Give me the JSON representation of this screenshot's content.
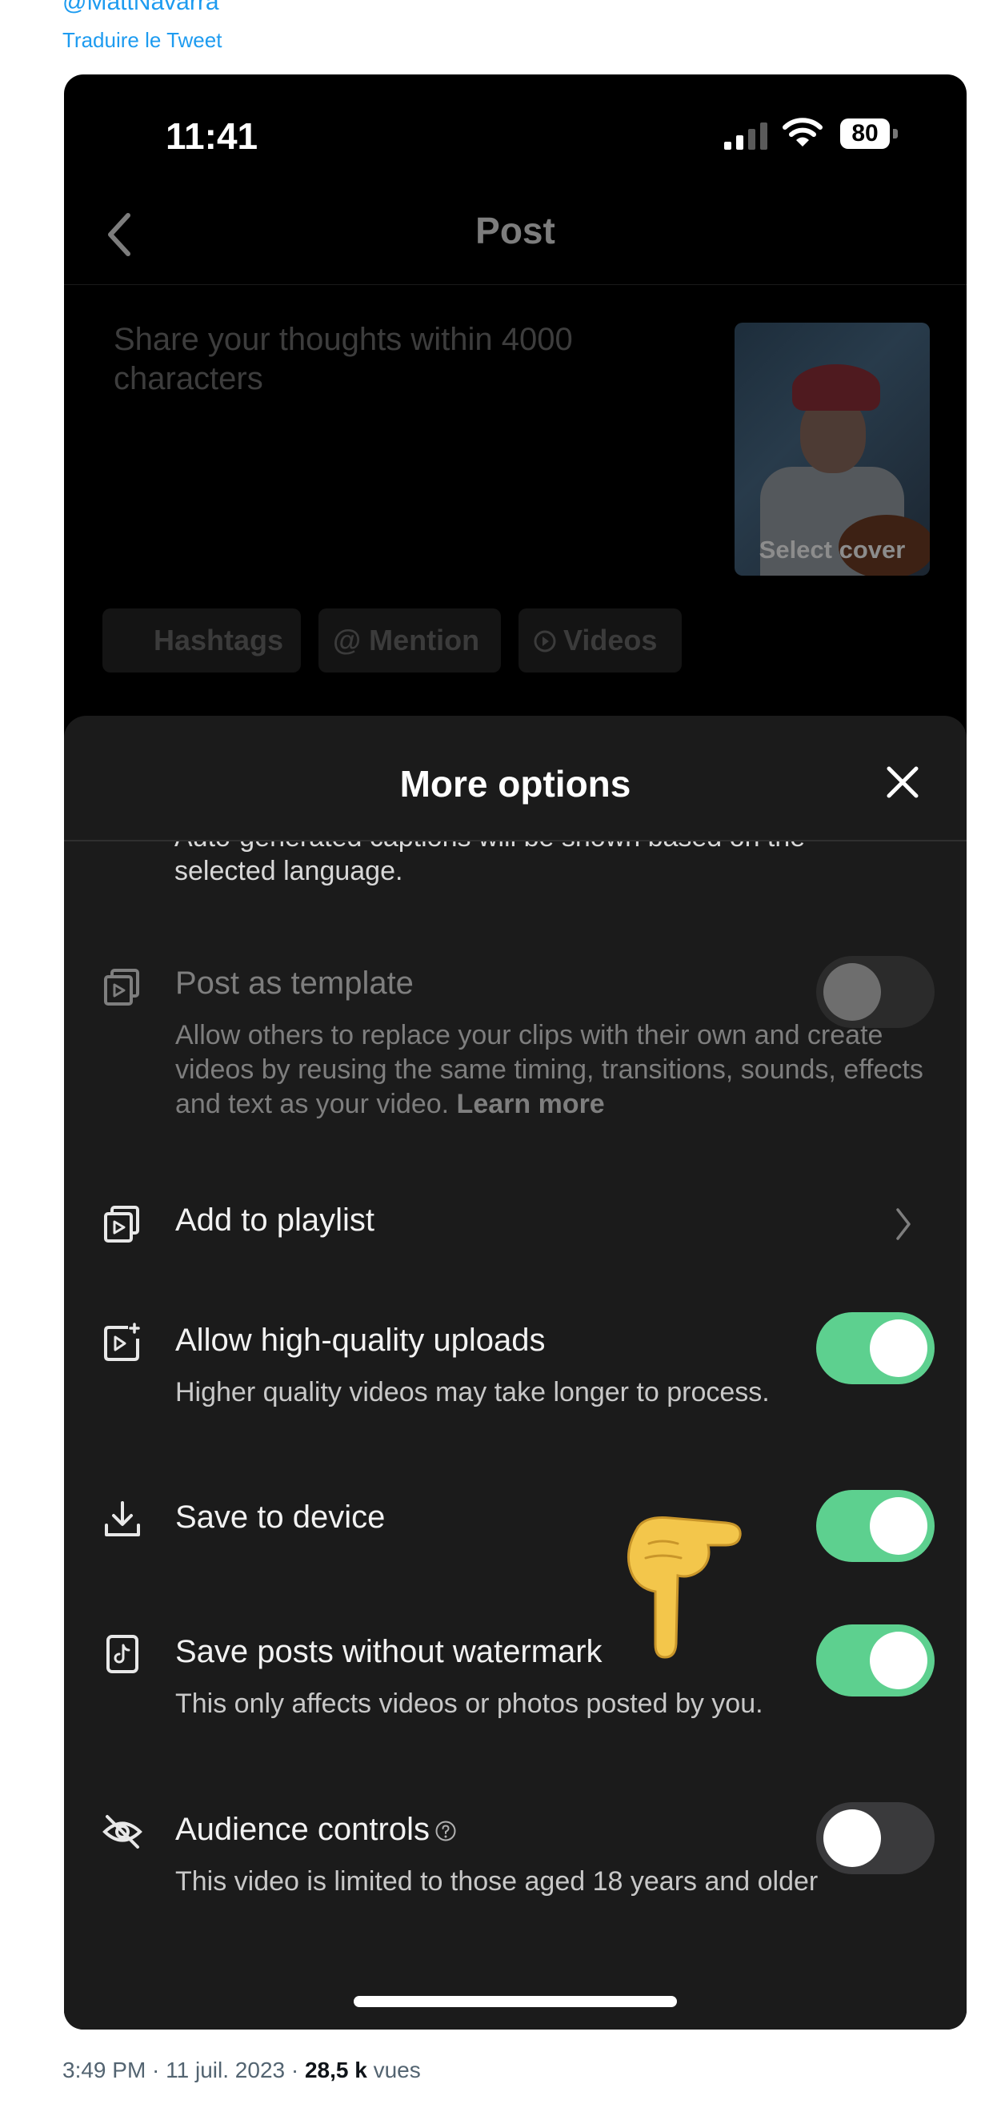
{
  "tweet": {
    "handle": "@MattNavarra",
    "translate_label": "Traduire le Tweet",
    "footer": {
      "time": "3:49 PM · 11 juil. 2023 · ",
      "views_count": "28,5 k",
      "views_label": " vues"
    }
  },
  "status_bar": {
    "time": "11:41",
    "battery": "80"
  },
  "post_screen": {
    "title": "Post",
    "caption_placeholder": "Share your thoughts within 4000 characters",
    "select_cover": "Select cover",
    "chips": [
      {
        "label": "Hashtags"
      },
      {
        "label": "@ Mention"
      },
      {
        "label": "Videos"
      }
    ]
  },
  "sheet": {
    "title": "More options",
    "cut_text_line1": "Auto-generated captions will be shown based on the",
    "cut_text_line2": "selected language.",
    "rows": [
      {
        "title": "Post as template",
        "desc": "Allow others to replace your clips with their own and create videos by reusing the same timing, transitions, sounds, effects and text as your video. ",
        "learn_more": "Learn more",
        "toggle": "off-disabled"
      },
      {
        "title": "Add to playlist"
      },
      {
        "title": "Allow high-quality uploads",
        "desc": "Higher quality videos may take longer to process.",
        "toggle": "on"
      },
      {
        "title": "Save to device",
        "toggle": "on"
      },
      {
        "title": "Save posts without watermark",
        "desc": "This only affects videos or photos posted by you.",
        "toggle": "on"
      },
      {
        "title": "Audience controls",
        "desc": "This video is limited to those aged 18 years and older",
        "toggle": "off"
      }
    ]
  },
  "colors": {
    "toggle_on": "#5dd08f",
    "link": "#1d9bf0",
    "sheet_bg": "#1b1b1b"
  }
}
